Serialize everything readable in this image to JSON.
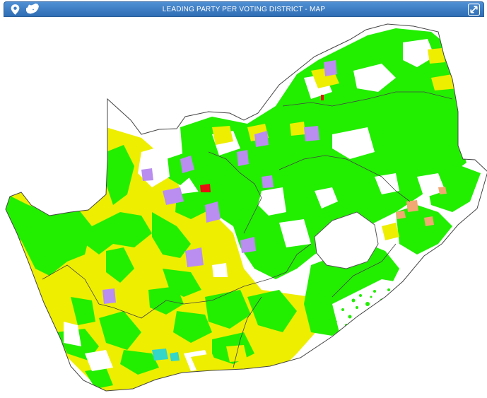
{
  "window": {
    "title": "LEADING PARTY PER VOTING DISTRICT - MAP"
  },
  "icons": {
    "pin": "map-pin-icon",
    "country": "country-outline-icon",
    "expand": "expand-icon"
  },
  "colors": {
    "titlebar": "#3a7cc4",
    "green": "#22ee00",
    "yellow": "#eeee00",
    "purple": "#b98ef0",
    "red": "#e81010",
    "orange": "#f2a872",
    "cyan": "#33d6c8",
    "outline": "#444444"
  }
}
